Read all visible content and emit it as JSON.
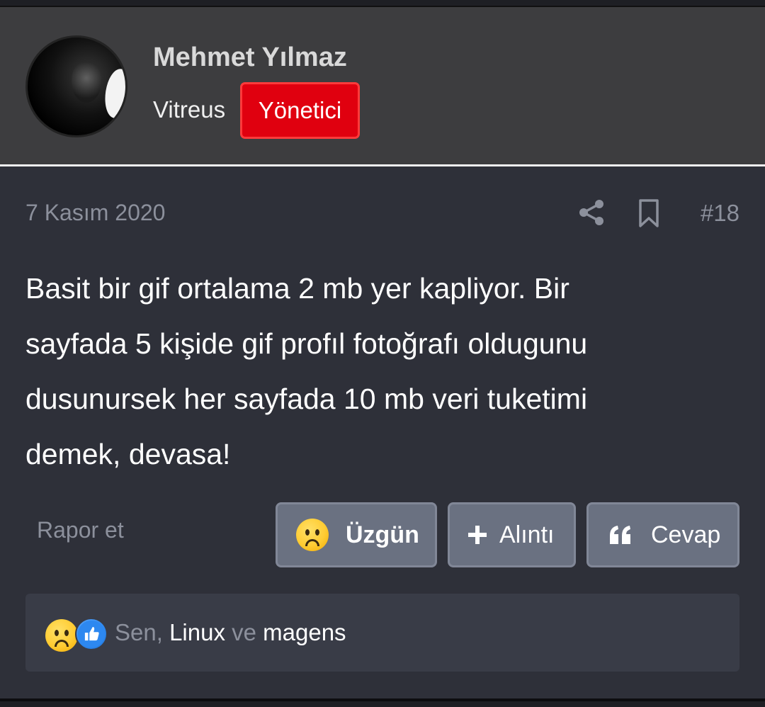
{
  "user": {
    "name": "Mehmet Yılmaz",
    "title": "Vitreus",
    "role_badge": "Yönetici"
  },
  "post": {
    "date": "7 Kasım 2020",
    "number": "#18",
    "message": [
      "Basit bir gif ortalama 2 mb yer kapliyor. Bir",
      "sayfada 5 kişide gif profıl fotoğrafı oldugunu",
      "dusunursek her sayfada 10 mb veri tuketimi",
      "demek, devasa!"
    ]
  },
  "actions": {
    "report_label": "Rapor et",
    "react_label": "Üzgün",
    "quote_label": "Alıntı",
    "reply_label": "Cevap"
  },
  "reactions": {
    "first": "Sen",
    "separator": ",",
    "second": "Linux",
    "conjunction": "ve",
    "third": "magens",
    "icons": [
      "sad-emoji-icon",
      "like-thumb-icon"
    ]
  },
  "colors": {
    "role_badge_bg": "#e0000f",
    "button_bg": "#6a7181",
    "post_bg": "#2e3039",
    "header_bg": "#3d3d3f"
  }
}
